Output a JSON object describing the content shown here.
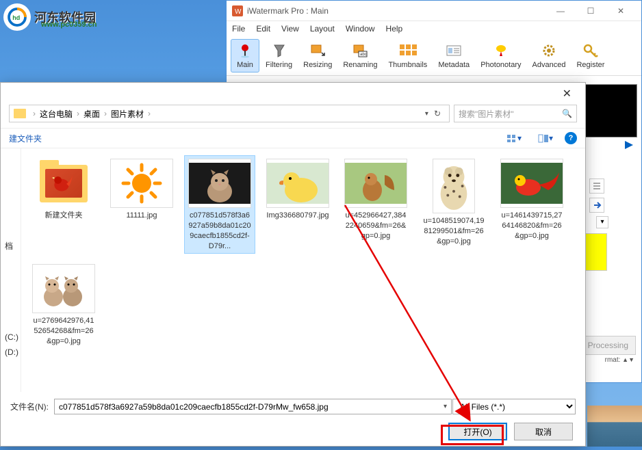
{
  "logo": {
    "text": "河东软件园",
    "url": "www.pc0359.cn"
  },
  "app": {
    "title": "iWatermark Pro : Main",
    "menu": [
      "File",
      "Edit",
      "View",
      "Layout",
      "Window",
      "Help"
    ],
    "toolbar": [
      {
        "label": "Main",
        "icon": "pin-red",
        "active": true
      },
      {
        "label": "Filtering",
        "icon": "funnel"
      },
      {
        "label": "Resizing",
        "icon": "resize"
      },
      {
        "label": "Renaming",
        "icon": "rename"
      },
      {
        "label": "Thumbnails",
        "icon": "grid"
      },
      {
        "label": "Metadata",
        "icon": "card"
      },
      {
        "label": "Photonotary",
        "icon": "marker"
      },
      {
        "label": "Advanced",
        "icon": "gear"
      },
      {
        "label": "Register",
        "icon": "key"
      }
    ],
    "processing_label": "Processing",
    "format_label": "rmat:"
  },
  "dialog": {
    "breadcrumb": [
      "这台电脑",
      "桌面",
      "图片素材"
    ],
    "search_placeholder": "搜索\"图片素材\"",
    "new_folder_label": "建文件夹",
    "sidebar_items": [
      "档",
      "(C:)",
      "(D:)"
    ],
    "files": [
      {
        "name": "新建文件夹",
        "type": "folder"
      },
      {
        "name": "11111.jpg",
        "type": "sun"
      },
      {
        "name": "c077851d578f3a6927a59b8da01c209caecfb1855cd2f-D79r...",
        "type": "cat",
        "selected": true
      },
      {
        "name": "Img336680797.jpg",
        "type": "duck"
      },
      {
        "name": "u=452966427,3842240659&fm=26&gp=0.jpg",
        "type": "squirrel"
      },
      {
        "name": "u=1048519074,1981299501&fm=26&gp=0.jpg",
        "type": "cheetah"
      },
      {
        "name": "u=1461439715,2764146820&fm=26&gp=0.jpg",
        "type": "pheasant"
      },
      {
        "name": "u=2769642976,4152654268&fm=26&gp=0.jpg",
        "type": "kittens"
      }
    ],
    "filename_label": "文件名(N):",
    "filename_value": "c077851d578f3a6927a59b8da01c209caecfb1855cd2f-D79rMw_fw658.jpg",
    "filetype_value": "All Files (*.*)",
    "open_btn": "打开(O)",
    "cancel_btn": "取消"
  }
}
